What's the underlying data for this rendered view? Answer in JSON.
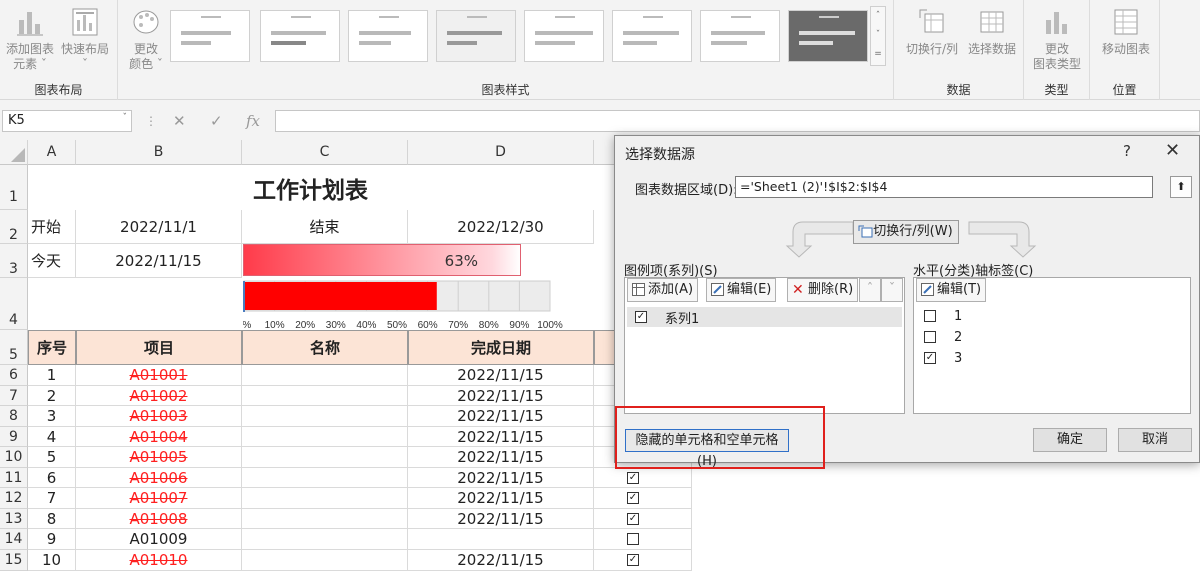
{
  "ribbon": {
    "groups": [
      {
        "label": "图表布局",
        "buttons": [
          {
            "label1": "添加图表",
            "label2": "元素 ˇ"
          },
          {
            "label1": "快速布局",
            "label2": "ˇ"
          }
        ]
      },
      {
        "label": "图表样式",
        "buttons": [
          {
            "label1": "更改",
            "label2": "颜色 ˇ"
          }
        ]
      },
      {
        "label": "数据",
        "buttons": [
          {
            "label1": "切换行/列",
            "label2": ""
          },
          {
            "label1": "选择数据",
            "label2": ""
          }
        ]
      },
      {
        "label": "类型",
        "buttons": [
          {
            "label1": "更改",
            "label2": "图表类型"
          }
        ]
      },
      {
        "label": "位置",
        "buttons": [
          {
            "label1": "移动图表",
            "label2": ""
          }
        ]
      }
    ],
    "gallery_scroll": [
      "ˆ",
      "ˇ",
      "="
    ]
  },
  "formula_bar": {
    "name_box": "K5",
    "dropdown": "ˇ",
    "sep": "⋮",
    "cancel": "✕",
    "enter": "✓",
    "fx": "fx",
    "formula": ""
  },
  "sheet": {
    "columns": [
      "A",
      "B",
      "C",
      "D"
    ],
    "rows": [
      "1",
      "2",
      "3",
      "4",
      "5",
      "6",
      "7",
      "8",
      "9",
      "10",
      "11",
      "12",
      "13",
      "14",
      "15"
    ],
    "title": "工作计划表",
    "start_label": "开始",
    "start_date": "2022/11/1",
    "end_label": "结束",
    "end_date": "2022/12/30",
    "today_label": "今天",
    "today_date": "2022/11/15",
    "progress_text": "63%",
    "progress": 0.63,
    "axis_ticks": [
      "0%",
      "10%",
      "20%",
      "30%",
      "40%",
      "50%",
      "60%",
      "70%",
      "80%",
      "90%",
      "100%"
    ],
    "headers": {
      "seq": "序号",
      "item": "项目",
      "name": "名称",
      "done_date": "完成日期"
    },
    "data_rows": [
      {
        "seq": "1",
        "item": "A01001",
        "strike": true,
        "date": "2022/11/15",
        "checked": true
      },
      {
        "seq": "2",
        "item": "A01002",
        "strike": true,
        "date": "2022/11/15",
        "checked": true
      },
      {
        "seq": "3",
        "item": "A01003",
        "strike": true,
        "date": "2022/11/15",
        "checked": true
      },
      {
        "seq": "4",
        "item": "A01004",
        "strike": true,
        "date": "2022/11/15",
        "checked": true
      },
      {
        "seq": "5",
        "item": "A01005",
        "strike": true,
        "date": "2022/11/15",
        "checked": true
      },
      {
        "seq": "6",
        "item": "A01006",
        "strike": true,
        "date": "2022/11/15",
        "checked": true
      },
      {
        "seq": "7",
        "item": "A01007",
        "strike": true,
        "date": "2022/11/15",
        "checked": true
      },
      {
        "seq": "8",
        "item": "A01008",
        "strike": true,
        "date": "2022/11/15",
        "checked": true
      },
      {
        "seq": "9",
        "item": "A01009",
        "strike": false,
        "date": "",
        "checked": false
      },
      {
        "seq": "10",
        "item": "A01010",
        "strike": true,
        "date": "2022/11/15",
        "checked": true
      }
    ]
  },
  "dialog": {
    "title": "选择数据源",
    "help": "?",
    "close": "✕",
    "range_label": "图表数据区域(D):",
    "range_value": "='Sheet1 (2)'!$I$2:$I$4",
    "range_btn": "⬆",
    "switch_label": "切换行/列(W)",
    "legend_label": "图例项(系列)(S)",
    "legend_buttons": {
      "add": "添加(A)",
      "edit": "编辑(E)",
      "delete": "删除(R)",
      "up": "ˆ",
      "down": "ˇ"
    },
    "series": [
      {
        "name": "系列1",
        "checked": true
      }
    ],
    "axis_label": "水平(分类)轴标签(C)",
    "axis_edit": "编辑(T)",
    "categories": [
      {
        "name": "1",
        "checked": false
      },
      {
        "name": "2",
        "checked": false
      },
      {
        "name": "3",
        "checked": true
      }
    ],
    "hidden_cells": "隐藏的单元格和空单元格(H)",
    "ok": "确定",
    "cancel": "取消",
    "check_mark": "✓"
  },
  "colors": {
    "accent_red": "#ff0000",
    "header_fill": "#fce4d6",
    "strike_red": "#ff2020",
    "highlight": "#e0201c"
  }
}
